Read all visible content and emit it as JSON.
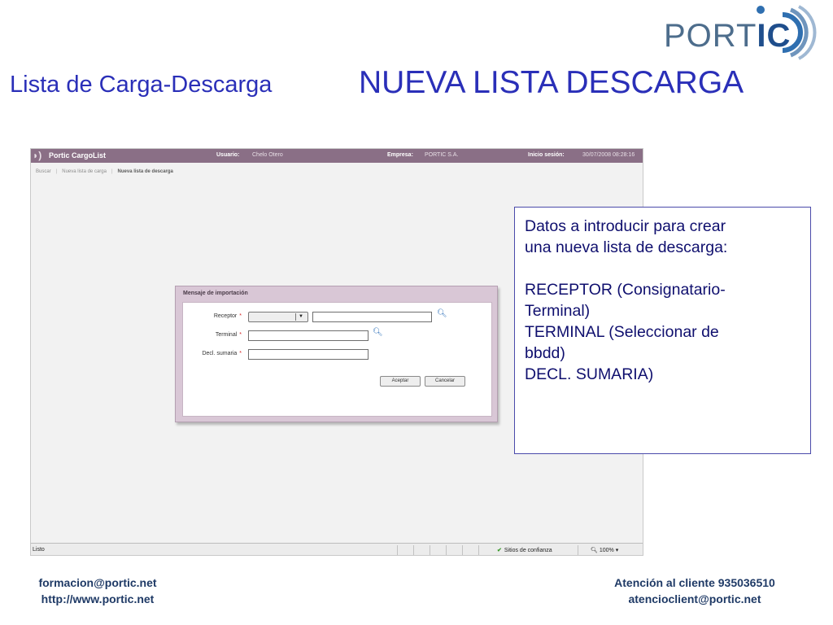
{
  "logo": {
    "text_a": "PORT",
    "text_b": "I",
    "text_c": "C"
  },
  "title": {
    "small": "Lista de Carga-Descarga",
    "big": "NUEVA LISTA DESCARGA"
  },
  "app": {
    "name": "Portic CargoList",
    "user_label": "Usuario:",
    "user_value": "Chelo Otero",
    "company_label": "Empresa:",
    "company_value": "PORTIC S.A.",
    "session_label": "Inicio sesión:",
    "session_value": "30/07/2008 08:28:16",
    "breadcrumb": [
      "Buscar",
      "Nueva lista de carga",
      "Nueva lista de descarga"
    ]
  },
  "dialog": {
    "title": "Mensaje de importación",
    "fields": [
      {
        "label": "Receptor",
        "required": "*"
      },
      {
        "label": "Terminal",
        "required": "*"
      },
      {
        "label": "Decl. sumaria",
        "required": "*"
      }
    ],
    "accept_label": "Aceptar",
    "cancel_label": "Cancelar"
  },
  "status_bar": {
    "status": "Listo",
    "zone": "Sitios de confianza",
    "zoom": "100%"
  },
  "callout": {
    "intro_1": "Datos a introducir para crear",
    "intro_2": "una nueva lista de descarga:",
    "line_1": "RECEPTOR (Consignatario-",
    "line_2": "Terminal)",
    "line_3": "TERMINAL (Seleccionar de",
    "line_4": "bbdd)",
    "line_5": "DECL. SUMARIA)"
  },
  "footer": {
    "left_1": "formacion@portic.net",
    "left_2": "http://www.portic.net",
    "right_1": "Atención al cliente 935036510",
    "right_2": "atencioclient@portic.net"
  },
  "colors": {
    "title": "#2a2fb8",
    "app_bar": "#8a6f86",
    "dialog_frame": "#d9c7d6",
    "footer": "#1f3a66"
  }
}
